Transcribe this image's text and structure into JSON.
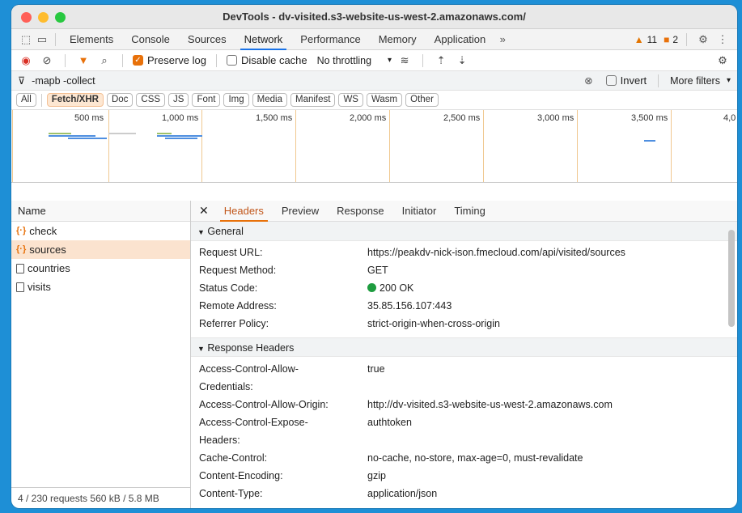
{
  "window": {
    "title": "DevTools - dv-visited.s3-website-us-west-2.amazonaws.com/"
  },
  "panel_tabs": [
    "Elements",
    "Console",
    "Sources",
    "Network",
    "Performance",
    "Memory",
    "Application"
  ],
  "active_panel": "Network",
  "badges": {
    "warnings": "11",
    "errors": "2"
  },
  "toolbar": {
    "preserve_log_label": "Preserve log",
    "disable_cache_label": "Disable cache",
    "throttling": "No throttling"
  },
  "filter": {
    "value": "-mapb -collect",
    "invert_label": "Invert",
    "more_filters_label": "More filters"
  },
  "type_filters": [
    "All",
    "Fetch/XHR",
    "Doc",
    "CSS",
    "JS",
    "Font",
    "Img",
    "Media",
    "Manifest",
    "WS",
    "Wasm",
    "Other"
  ],
  "timeline_ticks": [
    "500 ms",
    "1,000 ms",
    "1,500 ms",
    "2,000 ms",
    "2,500 ms",
    "3,000 ms",
    "3,500 ms",
    "4,0"
  ],
  "requests": {
    "header": "Name",
    "items": [
      {
        "name": "check",
        "type": "xhr"
      },
      {
        "name": "sources",
        "type": "xhr"
      },
      {
        "name": "countries",
        "type": "doc"
      },
      {
        "name": "visits",
        "type": "doc"
      }
    ],
    "footer": "4 / 230 requests    560 kB / 5.8 MB"
  },
  "detail_tabs": [
    "Headers",
    "Preview",
    "Response",
    "Initiator",
    "Timing"
  ],
  "general": {
    "title": "General",
    "rows": [
      {
        "k": "Request URL:",
        "v": "https://peakdv-nick-ison.fmecloud.com/api/visited/sources"
      },
      {
        "k": "Request Method:",
        "v": "GET"
      },
      {
        "k": "Status Code:",
        "v": "200 OK"
      },
      {
        "k": "Remote Address:",
        "v": "35.85.156.107:443"
      },
      {
        "k": "Referrer Policy:",
        "v": "strict-origin-when-cross-origin"
      }
    ]
  },
  "response_headers": {
    "title": "Response Headers",
    "rows": [
      {
        "k": "Access-Control-Allow-",
        "v": "true"
      },
      {
        "k": "Credentials:",
        "v": ""
      },
      {
        "k": "Access-Control-Allow-Origin:",
        "v": "http://dv-visited.s3-website-us-west-2.amazonaws.com"
      },
      {
        "k": "Access-Control-Expose-",
        "v": "authtoken"
      },
      {
        "k": "Headers:",
        "v": ""
      },
      {
        "k": "Cache-Control:",
        "v": "no-cache, no-store, max-age=0, must-revalidate"
      },
      {
        "k": "Content-Encoding:",
        "v": "gzip"
      },
      {
        "k": "Content-Type:",
        "v": "application/json"
      }
    ]
  }
}
